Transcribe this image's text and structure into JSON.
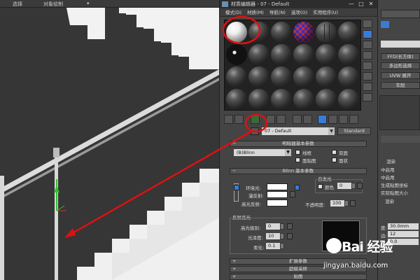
{
  "topbar": {
    "item1": "选择",
    "item2": "对象绘制",
    "item3": "▾"
  },
  "material_editor": {
    "title": "材质编辑器 - 07 - Default",
    "window_buttons": [
      "—",
      "□",
      "✕"
    ],
    "menu": [
      "模式(D)",
      "材质(M)",
      "导航(N)",
      "选项(O)",
      "实用程序(U)"
    ],
    "material_name": "07 - Default",
    "material_type": "Standard",
    "shader_rollout": "明暗器基本参数",
    "shader_type": "(B)Blinn",
    "shader_options": [
      "线框",
      "双面",
      "面贴图",
      "面状"
    ],
    "blinn_rollout": "Blinn 基本参数",
    "self_illum_label": "自发光",
    "color_label": "颜色",
    "self_illum_value": "0",
    "ambient_label": "环境光:",
    "diffuse_label": "漫反射:",
    "specular_label": "高光反射:",
    "opacity_label": "不透明度:",
    "opacity_value": "100",
    "highlight_label": "反射高光",
    "spec_level_label": "高光级别:",
    "spec_level_value": "0",
    "gloss_label": "光泽度:",
    "gloss_value": "10",
    "soften_label": "柔化:",
    "soften_value": "0.1",
    "rollout_ext": "扩展参数",
    "rollout_ss": "超级采样",
    "rollout_maps": "贴图"
  },
  "command_panel": {
    "ffd": "FFD(长方体)",
    "poly_select": "多边形选择",
    "uvw": "UVW 展开",
    "lathe": "车削",
    "render_label": "渲染",
    "enable1": "中启用",
    "enable2": "中启用",
    "gen_mapping": "生成贴图坐标",
    "real_world": "实际贴图大小",
    "world_label": "渲染",
    "thickness_label": "度:",
    "thickness_value": "30.0mm",
    "sides_label": "边:",
    "sides_value": "12",
    "angle_label": "度:",
    "angle_value": "0.0"
  },
  "watermark": {
    "brand": "Bai 经验",
    "url": "jingyan.baidu.com"
  },
  "colors": {
    "annotation_red": "#e01010",
    "accent_blue": "#3a7bd5",
    "panel_bg": "#444444"
  }
}
